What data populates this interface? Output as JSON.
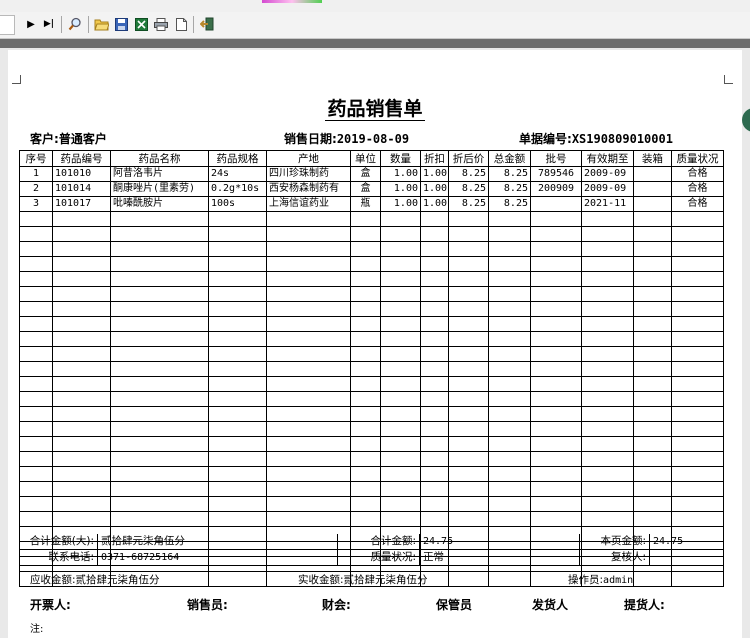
{
  "toolbar": {
    "buttons": [
      {
        "name": "next-page-button",
        "icon": "play-icon",
        "glyph": "▶"
      },
      {
        "name": "last-page-button",
        "icon": "skip-to-end-icon",
        "glyph": "▶|"
      },
      {
        "name": "zoom-button",
        "icon": "magnifier-icon",
        "glyph": "🔍"
      },
      {
        "name": "open-button",
        "icon": "folder-icon",
        "glyph": "📂"
      },
      {
        "name": "save-button",
        "icon": "floppy-disk-icon",
        "glyph": "💾"
      },
      {
        "name": "export-excel-button",
        "icon": "excel-icon",
        "glyph": "X"
      },
      {
        "name": "print-button",
        "icon": "printer-icon",
        "glyph": "🖶"
      },
      {
        "name": "new-page-button",
        "icon": "blank-page-icon",
        "glyph": "🗋"
      },
      {
        "name": "exit-button",
        "icon": "exit-door-icon",
        "glyph": "⇦"
      }
    ]
  },
  "doc": {
    "title": "药品销售单",
    "customer_label": "客户:",
    "customer_value": "普通客户",
    "date_label": "销售日期:",
    "date_value": "2019-08-09",
    "docno_label": "单据编号:",
    "docno_value": "XS190809010001"
  },
  "table": {
    "headers": [
      "序号",
      "药品编号",
      "药品名称",
      "药品规格",
      "产地",
      "单位",
      "数量",
      "折扣",
      "折后价",
      "总金额",
      "批号",
      "有效期至",
      "装箱",
      "质量状况"
    ],
    "rows": [
      [
        "1",
        "101010",
        "阿昔洛韦片",
        "24s",
        "四川珍珠制药",
        "盒",
        "1.00",
        "1.00",
        "8.25",
        "8.25",
        "789546",
        "2009-09",
        "",
        "合格"
      ],
      [
        "2",
        "101014",
        "酮康唑片(里素劳)",
        "0.2g*10s",
        "西安杨森制药有",
        "盒",
        "1.00",
        "1.00",
        "8.25",
        "8.25",
        "200909",
        "2009-09",
        "",
        "合格"
      ],
      [
        "3",
        "101017",
        "吡嗪酰胺片",
        "100s",
        "上海信谊药业",
        "瓶",
        "1.00",
        "1.00",
        "8.25",
        "8.25",
        "",
        "2021-11",
        "",
        "合格"
      ]
    ],
    "empty_rows": 25
  },
  "footer": {
    "total_upper_label": "合计金额(大):",
    "total_upper_value": "贰拾肆元柒角伍分",
    "total_label": "合计金额:",
    "total_value": "24.75",
    "page_total_label": "本页金额:",
    "page_total_value": "24.75",
    "phone_label": "联系电话:",
    "phone_value": "0371-68725164",
    "quality_label": "质量状况:",
    "quality_value": "正常",
    "reviewer_label": "复核人:",
    "reviewer_value": "",
    "receivable_label": "应收金额:",
    "receivable_value": "贰拾肆元柒角伍分",
    "received_label": "实收金额:",
    "received_value": "贰拾肆元柒角伍分",
    "operator_label": "操作员:",
    "operator_value": "admin"
  },
  "signatures": {
    "invoicer": "开票人:",
    "salesperson": "销售员:",
    "finance": "财会:",
    "keeper": "保管员",
    "shipper": "发货人",
    "receiver": "提货人:"
  },
  "note_label": "注:"
}
